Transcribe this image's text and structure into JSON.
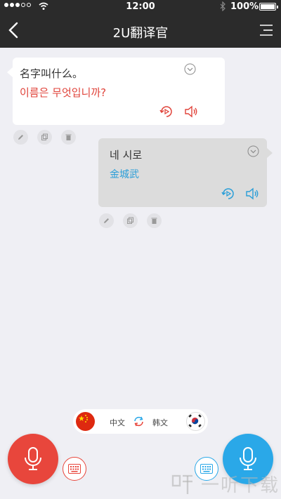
{
  "status": {
    "time": "12:00",
    "battery": "100%"
  },
  "nav": {
    "title": "2U翻译官"
  },
  "messages": [
    {
      "source": "名字叫什么。",
      "translation": "이름은 무엇입니까?"
    },
    {
      "source": "네 시로",
      "translation": "金城武"
    }
  ],
  "lang_bar": {
    "source_lang": "中文",
    "target_lang": "韩文"
  },
  "colors": {
    "red_accent": "#e8463c",
    "blue_accent": "#2aa8e8",
    "nav_bg": "#2b2b2b",
    "page_bg": "#efeff4"
  },
  "icons": {
    "back": "chevron-left-icon",
    "menu": "menu-icon",
    "expand": "chevron-down-icon",
    "replay": "replay-icon",
    "speaker": "speaker-icon",
    "edit": "pencil-icon",
    "copy": "copy-icon",
    "delete": "trash-icon",
    "swap": "swap-icon",
    "mic": "microphone-icon",
    "keyboard": "keyboard-icon"
  },
  "watermark": {
    "text": "一听下载"
  }
}
